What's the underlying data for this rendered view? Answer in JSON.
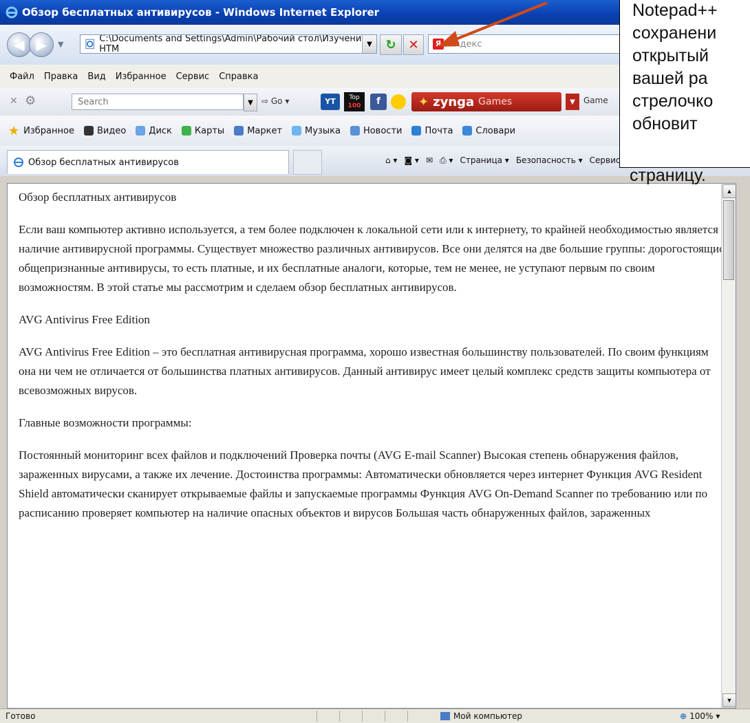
{
  "window": {
    "title": "Обзор бесплатных антивирусов - Windows Internet Explorer"
  },
  "address_bar": {
    "url": "C:\\Documents and Settings\\Admin\\Рабочий стол\\Изучение HTM",
    "search_placeholder": "Яндекс"
  },
  "menu": [
    "Файл",
    "Правка",
    "Вид",
    "Избранное",
    "Сервис",
    "Справка"
  ],
  "toolbar": {
    "search_placeholder": "Search",
    "go_label": "Go",
    "yt_label": "YT",
    "top100_label_top": "Top",
    "top100_label_bottom": "100",
    "fb_label": "f",
    "zynga_label": "zynga",
    "zynga_games_label": "Games",
    "games_label": "Game"
  },
  "favorites_bar": {
    "favorites_label": "Избранное",
    "items": [
      "Видео",
      "Диск",
      "Карты",
      "Маркет",
      "Музыка",
      "Новости",
      "Почта",
      "Словари"
    ]
  },
  "tabs": {
    "active_tab": "Обзор бесплатных антивирусов",
    "command_items": [
      "Страница ▾",
      "Безопасность ▾",
      "Сервис ▾"
    ]
  },
  "page_content": {
    "paragraphs": [
      "Обзор бесплатных антивирусов",
      "Если ваш компьютер активно используется, а тем более подключен к локальной сети или к интернету, то крайней необходимостью является наличие антивирусной программы. Существует множество различных антивирусов. Все они делятся на две большие группы: дорогостоящие общепризнанные антивирусы, то есть платные, и их бесплатные аналоги, которые, тем не менее, не уступают первым по своим возможностям. В этой статье мы рассмотрим и сделаем обзор бесплатных антивирусов.",
      "AVG Antivirus Free Edition",
      "AVG Antivirus Free Edition – это бесплатная антивирусная программа, хорошо известная большинству пользователей. По своим функциям она ни чем не отличается от большинства платных антивирусов. Данный антивирус имеет целый комплекс средств защиты компьютера от всевозможных вирусов.",
      "Главные возможности программы:",
      "Постоянный мониторинг всех файлов и подключений Проверка почты (AVG E-mail Scanner) Высокая степень обнаружения файлов, зараженных вирусами, а также их лечение. Достоинства программы: Автоматически обновляется через интернет Функция AVG Resident Shield автоматически сканирует открываемые файлы и запускаемые программы Функция AVG On-Demand Scanner по требованию или по расписанию проверяет компьютер на наличие опасных объектов и вирусов Большая часть обнаруженных файлов, зараженных"
    ]
  },
  "status_bar": {
    "status": "Готово",
    "zone": "Мой компьютер",
    "zoom": "100%"
  },
  "annotation": {
    "lines": [
      "Notepad++",
      "сохранени",
      "открытый",
      "вашей ра",
      "стрелочко",
      "обновит"
    ],
    "tail": "страницу.",
    "arrow_color": "#d04a1a"
  }
}
